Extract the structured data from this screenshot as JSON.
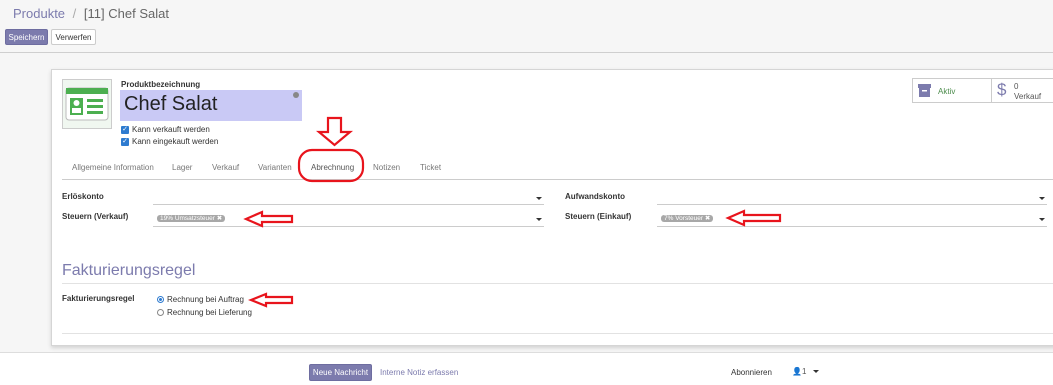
{
  "breadcrumb": {
    "parent": "Produkte",
    "separator": "/",
    "current": "[11] Chef Salat"
  },
  "buttons": {
    "save": "Speichern",
    "discard": "Verwerfen"
  },
  "product": {
    "name_label": "Produktbezeichnung",
    "name": "Chef Salat",
    "can_sell": "Kann verkauft werden",
    "can_purchase": "Kann eingekauft werden"
  },
  "smart_buttons": {
    "active": "Aktiv",
    "sales_count": "0",
    "sales_label": "Verkauf"
  },
  "tabs": [
    "Allgemeine Information",
    "Lager",
    "Verkauf",
    "Varianten",
    "Abrechnung",
    "Notizen",
    "Ticket"
  ],
  "accounting": {
    "income_account_label": "Erlöskonto",
    "income_account_value": "",
    "sales_tax_label": "Steuern (Verkauf)",
    "sales_tax_tag": "19% Umsatzsteuer",
    "expense_account_label": "Aufwandskonto",
    "expense_account_value": "",
    "purchase_tax_label": "Steuern (Einkauf)",
    "purchase_tax_tag": "7% Vorsteuer"
  },
  "invoicing": {
    "section_title": "Fakturierungsregel",
    "field_label": "Fakturierungsregel",
    "options": [
      "Rechnung bei Auftrag",
      "Rechnung bei Lieferung"
    ],
    "selected": 0
  },
  "chatter": {
    "new_message": "Neue Nachricht",
    "log_note": "Interne Notiz erfassen",
    "follow": "Abonnieren",
    "followers_count": "1"
  },
  "colors": {
    "primary": "#7c7bad",
    "annotation": "#e8141c",
    "link": "#7c7bad"
  },
  "icons": {
    "product_image": "id-card-icon",
    "archive": "archive-icon",
    "dollar": "dollar-icon",
    "remove": "x-icon",
    "user": "user-icon"
  }
}
